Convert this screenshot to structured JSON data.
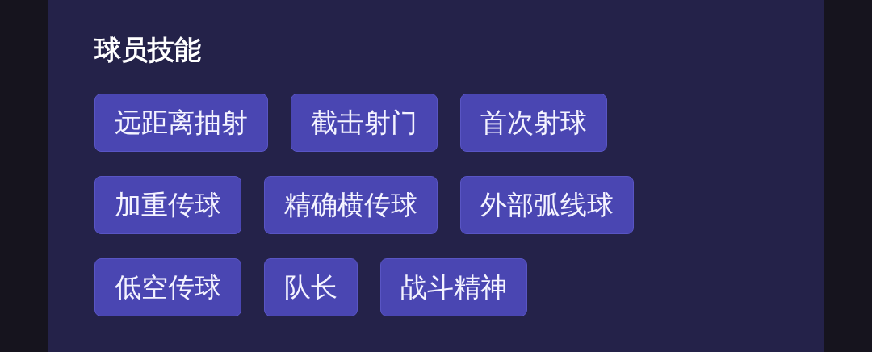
{
  "section": {
    "title": "球员技能",
    "skills": [
      [
        "远距离抽射",
        "截击射门",
        "首次射球"
      ],
      [
        "加重传球",
        "精确横传球",
        "外部弧线球"
      ],
      [
        "低空传球",
        "队长",
        "战斗精神"
      ]
    ]
  }
}
